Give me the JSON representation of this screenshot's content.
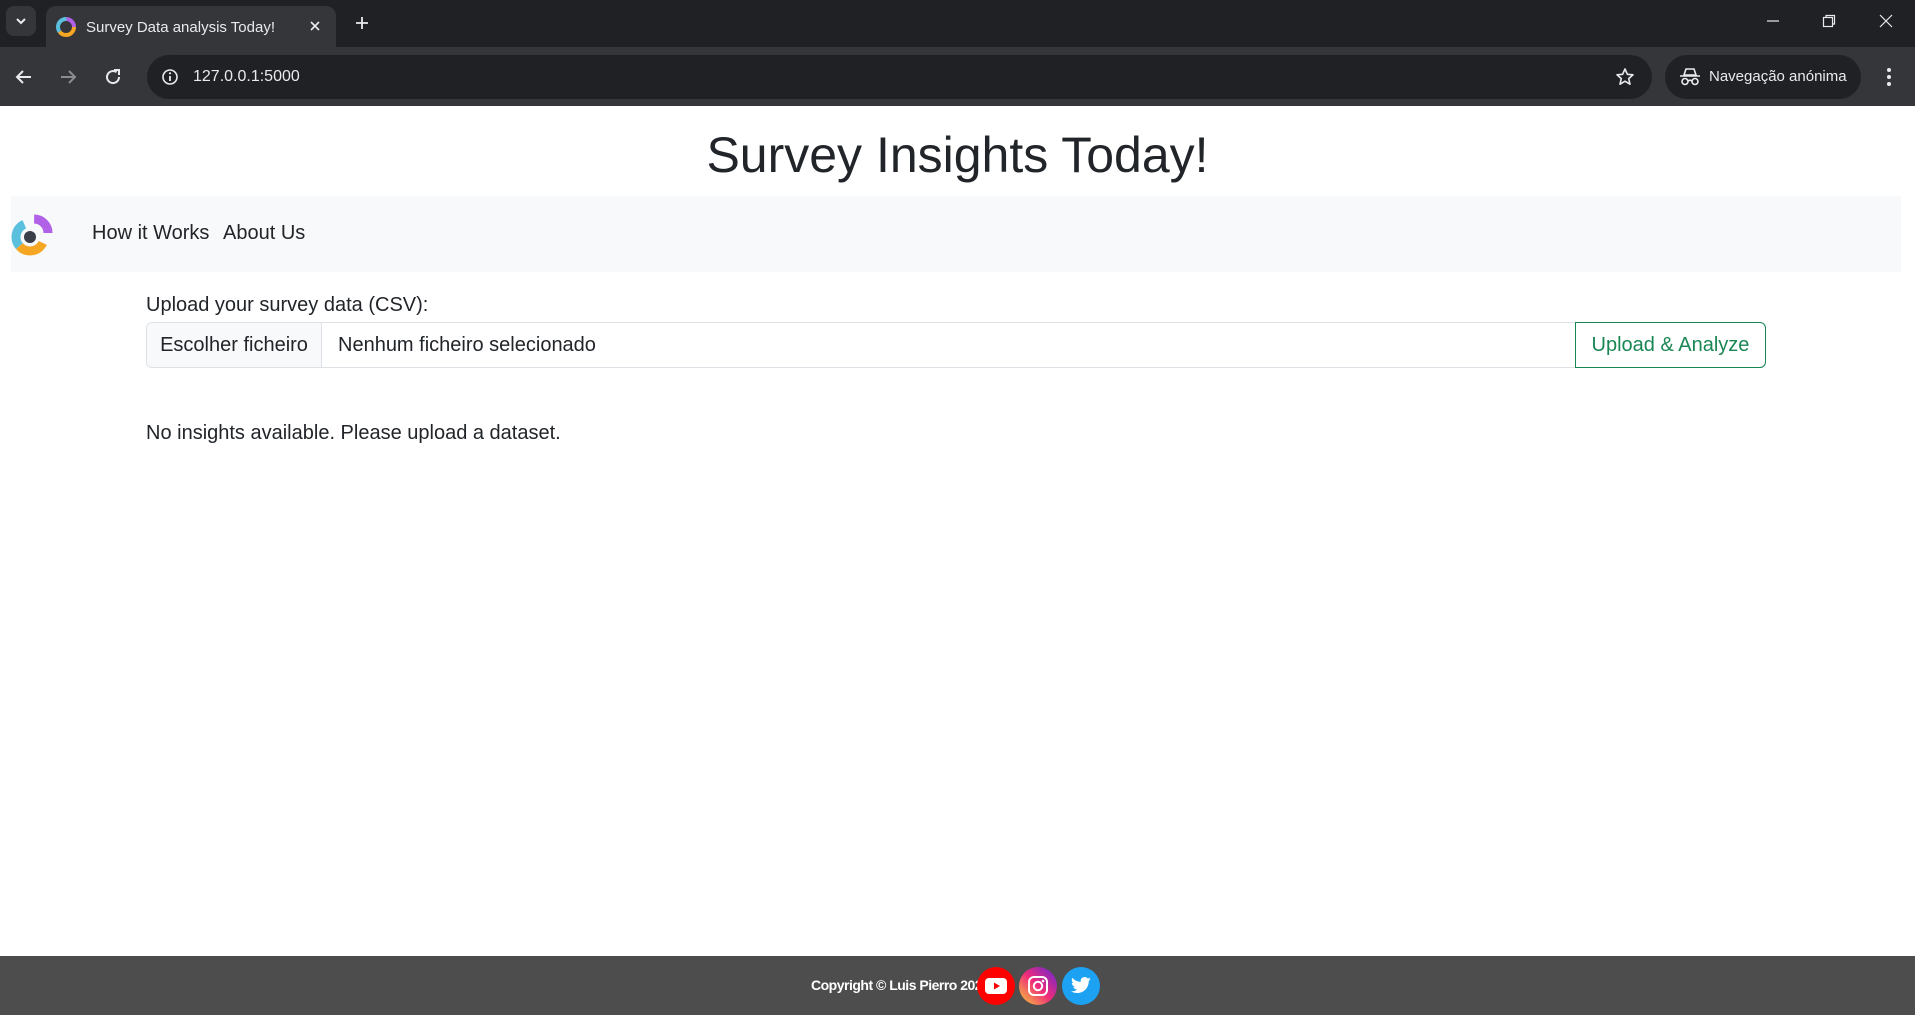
{
  "browser": {
    "tab_title": "Survey Data analysis Today!",
    "url": "127.0.0.1:5000",
    "incognito_label": "Navegação anónima",
    "icons": {
      "tab_list": "chevron-down-icon",
      "close_tab": "close-icon",
      "new_tab": "plus-icon",
      "back": "arrow-left-icon",
      "forward": "arrow-right-icon",
      "reload": "reload-icon",
      "site_info": "info-icon",
      "bookmark": "star-icon",
      "incognito": "incognito-icon",
      "menu": "kebab-menu-icon",
      "minimize": "minimize-icon",
      "restore": "restore-icon",
      "close_window": "close-icon"
    }
  },
  "page": {
    "title": "Survey Insights Today!",
    "nav": {
      "items": [
        {
          "label": "How it Works"
        },
        {
          "label": "About Us"
        }
      ]
    },
    "upload": {
      "label": "Upload your survey data (CSV):",
      "choose_file_label": "Escolher ficheiro",
      "file_status": "Nenhum ficheiro selecionado",
      "submit_label": "Upload & Analyze"
    },
    "message": "No insights available. Please upload a dataset.",
    "footer": {
      "copyright": "Copyright © Luis Pierro 2024",
      "social": [
        {
          "name": "youtube-icon",
          "color": "#ff0000"
        },
        {
          "name": "instagram-icon",
          "color": "#e1306c"
        },
        {
          "name": "twitter-icon",
          "color": "#1da1f2"
        }
      ]
    }
  },
  "colors": {
    "accent_success": "#198754",
    "navbar_bg": "#f8f9fa",
    "footer_bg": "#4d4d4d",
    "chrome_dark": "#202124",
    "chrome_toolbar": "#35363a"
  }
}
